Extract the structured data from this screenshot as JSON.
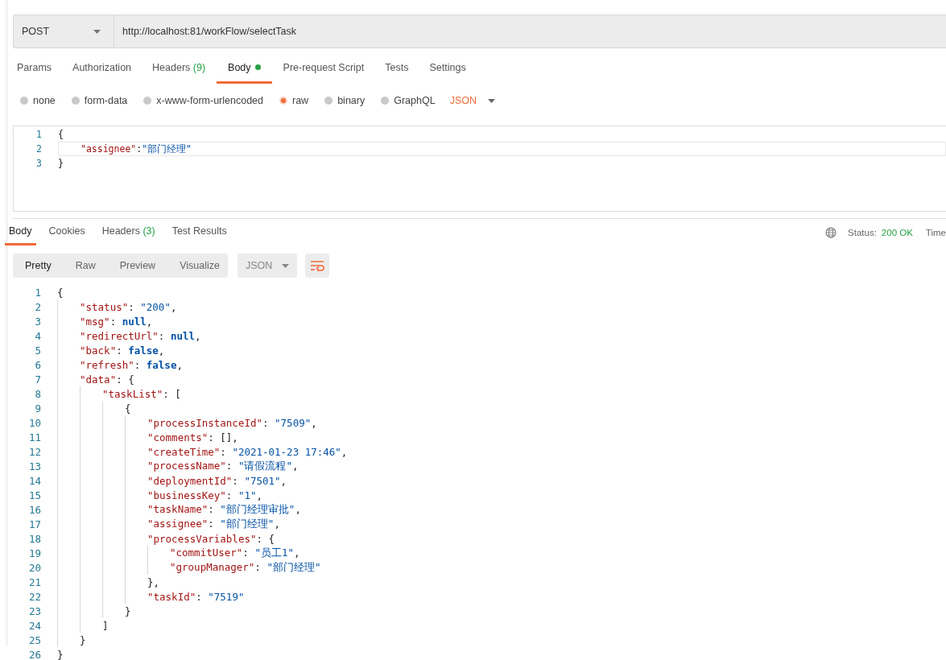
{
  "request": {
    "method": "POST",
    "url": "http://localhost:81/workFlow/selectTask"
  },
  "request_tabs": [
    {
      "label": "Params",
      "selected": false,
      "dot": false
    },
    {
      "label": "Authorization",
      "selected": false,
      "dot": false
    },
    {
      "label": "Headers",
      "count": "(9)",
      "selected": false,
      "dot": false
    },
    {
      "label": "Body",
      "selected": true,
      "dot": true
    },
    {
      "label": "Pre-request Script",
      "selected": false,
      "dot": false
    },
    {
      "label": "Tests",
      "selected": false,
      "dot": false
    },
    {
      "label": "Settings",
      "selected": false,
      "dot": false
    }
  ],
  "body_types": [
    {
      "label": "none",
      "selected": false
    },
    {
      "label": "form-data",
      "selected": false
    },
    {
      "label": "x-www-form-urlencoded",
      "selected": false
    },
    {
      "label": "raw",
      "selected": true
    },
    {
      "label": "binary",
      "selected": false
    },
    {
      "label": "GraphQL",
      "selected": false
    }
  ],
  "body_format": "JSON",
  "request_body": [
    {
      "number": "1",
      "current": false,
      "tokens": [
        {
          "kind": "open",
          "text": "{"
        }
      ]
    },
    {
      "number": "2",
      "current": true,
      "tokens": [
        {
          "kind": "key",
          "text": "\"assignee\""
        },
        {
          "kind": "punct",
          "text": ":"
        },
        {
          "kind": "str",
          "text": "\"部门经理\""
        }
      ]
    },
    {
      "number": "3",
      "current": false,
      "tokens": [
        {
          "kind": "close",
          "text": "}"
        }
      ]
    }
  ],
  "response_tabs": [
    {
      "label": "Body",
      "selected": true
    },
    {
      "label": "Cookies",
      "selected": false
    },
    {
      "label": "Headers",
      "count": "(3)",
      "selected": false
    },
    {
      "label": "Test Results",
      "selected": false
    }
  ],
  "status": {
    "label": "Status:",
    "value": "200 OK",
    "time_label": "Time"
  },
  "view_modes": [
    {
      "label": "Pretty",
      "selected": true
    },
    {
      "label": "Raw",
      "selected": false
    },
    {
      "label": "Preview",
      "selected": false
    },
    {
      "label": "Visualize",
      "selected": false
    }
  ],
  "response_format": "JSON",
  "response_body": [
    {
      "number": "1",
      "tokens": [
        {
          "kind": "open",
          "text": "{"
        }
      ]
    },
    {
      "number": "2",
      "tokens": [
        {
          "kind": "key",
          "text": "\"status\""
        },
        {
          "kind": "punct",
          "text": ": "
        },
        {
          "kind": "str",
          "text": "\"200\""
        },
        {
          "kind": "punct",
          "text": ","
        }
      ]
    },
    {
      "number": "3",
      "tokens": [
        {
          "kind": "key",
          "text": "\"msg\""
        },
        {
          "kind": "punct",
          "text": ": "
        },
        {
          "kind": "kw",
          "text": "null"
        },
        {
          "kind": "punct",
          "text": ","
        }
      ]
    },
    {
      "number": "4",
      "tokens": [
        {
          "kind": "key",
          "text": "\"redirectUrl\""
        },
        {
          "kind": "punct",
          "text": ": "
        },
        {
          "kind": "kw",
          "text": "null"
        },
        {
          "kind": "punct",
          "text": ","
        }
      ]
    },
    {
      "number": "5",
      "tokens": [
        {
          "kind": "key",
          "text": "\"back\""
        },
        {
          "kind": "punct",
          "text": ": "
        },
        {
          "kind": "kw",
          "text": "false"
        },
        {
          "kind": "punct",
          "text": ","
        }
      ]
    },
    {
      "number": "6",
      "tokens": [
        {
          "kind": "key",
          "text": "\"refresh\""
        },
        {
          "kind": "punct",
          "text": ": "
        },
        {
          "kind": "kw",
          "text": "false"
        },
        {
          "kind": "punct",
          "text": ","
        }
      ]
    },
    {
      "number": "7",
      "tokens": [
        {
          "kind": "key",
          "text": "\"data\""
        },
        {
          "kind": "punct",
          "text": ": "
        },
        {
          "kind": "open",
          "text": "{"
        }
      ]
    },
    {
      "number": "8",
      "tokens": [
        {
          "kind": "key",
          "text": "\"taskList\""
        },
        {
          "kind": "punct",
          "text": ": "
        },
        {
          "kind": "open",
          "text": "["
        }
      ]
    },
    {
      "number": "9",
      "tokens": [
        {
          "kind": "open",
          "text": "{"
        }
      ]
    },
    {
      "number": "10",
      "tokens": [
        {
          "kind": "key",
          "text": "\"processInstanceId\""
        },
        {
          "kind": "punct",
          "text": ": "
        },
        {
          "kind": "str",
          "text": "\"7509\""
        },
        {
          "kind": "punct",
          "text": ","
        }
      ]
    },
    {
      "number": "11",
      "tokens": [
        {
          "kind": "key",
          "text": "\"comments\""
        },
        {
          "kind": "punct",
          "text": ": [],"
        }
      ]
    },
    {
      "number": "12",
      "tokens": [
        {
          "kind": "key",
          "text": "\"createTime\""
        },
        {
          "kind": "punct",
          "text": ": "
        },
        {
          "kind": "str",
          "text": "\"2021-01-23 17:46\""
        },
        {
          "kind": "punct",
          "text": ","
        }
      ]
    },
    {
      "number": "13",
      "tokens": [
        {
          "kind": "key",
          "text": "\"processName\""
        },
        {
          "kind": "punct",
          "text": ": "
        },
        {
          "kind": "str",
          "text": "\"请假流程\""
        },
        {
          "kind": "punct",
          "text": ","
        }
      ]
    },
    {
      "number": "14",
      "tokens": [
        {
          "kind": "key",
          "text": "\"deploymentId\""
        },
        {
          "kind": "punct",
          "text": ": "
        },
        {
          "kind": "str",
          "text": "\"7501\""
        },
        {
          "kind": "punct",
          "text": ","
        }
      ]
    },
    {
      "number": "15",
      "tokens": [
        {
          "kind": "key",
          "text": "\"businessKey\""
        },
        {
          "kind": "punct",
          "text": ": "
        },
        {
          "kind": "str",
          "text": "\"1\""
        },
        {
          "kind": "punct",
          "text": ","
        }
      ]
    },
    {
      "number": "16",
      "tokens": [
        {
          "kind": "key",
          "text": "\"taskName\""
        },
        {
          "kind": "punct",
          "text": ": "
        },
        {
          "kind": "str",
          "text": "\"部门经理审批\""
        },
        {
          "kind": "punct",
          "text": ","
        }
      ]
    },
    {
      "number": "17",
      "tokens": [
        {
          "kind": "key",
          "text": "\"assignee\""
        },
        {
          "kind": "punct",
          "text": ": "
        },
        {
          "kind": "str",
          "text": "\"部门经理\""
        },
        {
          "kind": "punct",
          "text": ","
        }
      ]
    },
    {
      "number": "18",
      "tokens": [
        {
          "kind": "key",
          "text": "\"processVariables\""
        },
        {
          "kind": "punct",
          "text": ": "
        },
        {
          "kind": "open",
          "text": "{"
        }
      ]
    },
    {
      "number": "19",
      "tokens": [
        {
          "kind": "key",
          "text": "\"commitUser\""
        },
        {
          "kind": "punct",
          "text": ": "
        },
        {
          "kind": "str",
          "text": "\"员工1\""
        },
        {
          "kind": "punct",
          "text": ","
        }
      ]
    },
    {
      "number": "20",
      "tokens": [
        {
          "kind": "key",
          "text": "\"groupManager\""
        },
        {
          "kind": "punct",
          "text": ": "
        },
        {
          "kind": "str",
          "text": "\"部门经理\""
        }
      ]
    },
    {
      "number": "21",
      "tokens": [
        {
          "kind": "close",
          "text": "}"
        },
        {
          "kind": "punct",
          "text": ","
        }
      ]
    },
    {
      "number": "22",
      "tokens": [
        {
          "kind": "key",
          "text": "\"taskId\""
        },
        {
          "kind": "punct",
          "text": ": "
        },
        {
          "kind": "str",
          "text": "\"7519\""
        }
      ]
    },
    {
      "number": "23",
      "tokens": [
        {
          "kind": "close",
          "text": "}"
        }
      ]
    },
    {
      "number": "24",
      "tokens": [
        {
          "kind": "close",
          "text": "]"
        }
      ]
    },
    {
      "number": "25",
      "tokens": [
        {
          "kind": "close",
          "text": "}"
        }
      ]
    },
    {
      "number": "26",
      "tokens": [
        {
          "kind": "close",
          "text": "}"
        }
      ]
    }
  ]
}
